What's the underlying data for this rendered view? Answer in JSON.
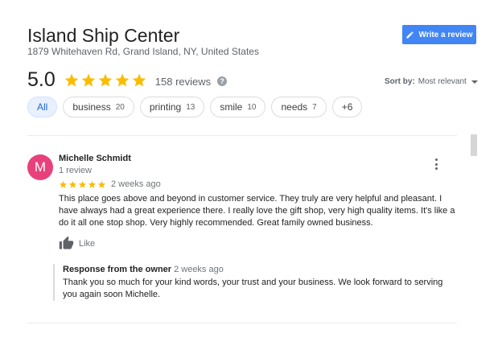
{
  "business": {
    "name": "Island Ship Center",
    "address": "1879 Whitehaven Rd, Grand Island, NY, United States"
  },
  "write_review": {
    "label": "Write a review",
    "icon": "pencil-icon",
    "color": "#4285f4"
  },
  "rating": {
    "value": "5.0",
    "stars": 5,
    "review_count": "158 reviews",
    "star_color": "#fbbc04"
  },
  "sort": {
    "label": "Sort by:",
    "value": "Most relevant"
  },
  "chips": [
    {
      "label": "All",
      "count": "",
      "active": true
    },
    {
      "label": "business",
      "count": "20"
    },
    {
      "label": "printing",
      "count": "13"
    },
    {
      "label": "smile",
      "count": "10"
    },
    {
      "label": "needs",
      "count": "7"
    },
    {
      "label": "+6",
      "count": ""
    }
  ],
  "review": {
    "avatar_letter": "M",
    "avatar_color": "#e8407a",
    "author": "Michelle Schmidt",
    "author_meta": "1 review",
    "stars": 5,
    "date": "2 weeks ago",
    "text": "This place goes above and beyond in customer service. They truly are very helpful and pleasant. I have always had a great experience there. I really love the gift shop, very high quality items. It's like a do it all one stop shop. Very highly recommended. Great family owned business.",
    "like_label": "Like",
    "response": {
      "title": "Response from the owner",
      "date": "2 weeks ago",
      "text": "Thank you so much for your kind words, your trust and your business. We look forward to serving you again soon Michelle."
    }
  }
}
